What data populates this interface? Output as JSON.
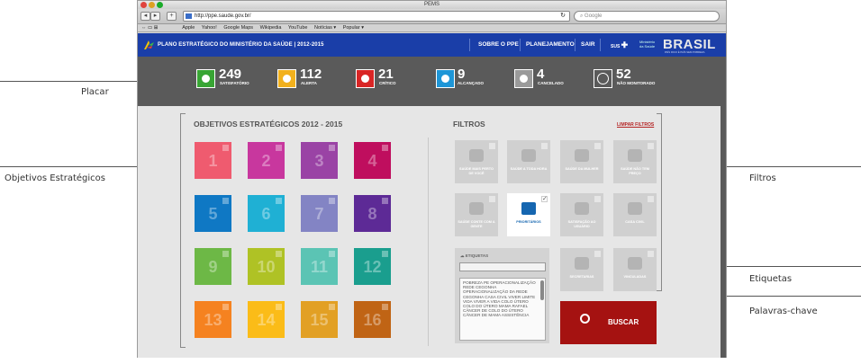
{
  "browser": {
    "window_title": "PEMS",
    "url": "http://ppe.saude.gov.br/",
    "search_placeholder": "Google",
    "bookmarks": [
      "Apple",
      "Yahoo!",
      "Google Maps",
      "Wikipedia",
      "YouTube",
      "Notícias ▾",
      "Popular ▾"
    ]
  },
  "header": {
    "title": "PLANO ESTRATÉGICO DO MINISTÉRIO DA SAÚDE | 2012-2015",
    "nav": [
      "SOBRE O PPE",
      "PLANEJAMENTO",
      "SAIR"
    ],
    "sus": "SUS",
    "ministerio": "Ministério da Saúde",
    "brasil": "BRASIL",
    "brasil_sub": "PAÍS RICO É PAÍS SEM POBREZA"
  },
  "placar": [
    {
      "value": "249",
      "label": "SATISFATÓRIO",
      "color": "#38a534"
    },
    {
      "value": "112",
      "label": "ALERTA",
      "color": "#f2b11d"
    },
    {
      "value": "21",
      "label": "CRÍTICO",
      "color": "#d92525"
    },
    {
      "value": "9",
      "label": "ALCANÇADO",
      "color": "#1e96d7"
    },
    {
      "value": "4",
      "label": "CANCELADO",
      "color": "#9a9a9a"
    },
    {
      "value": "52",
      "label": "NÃO MONITORADO",
      "color": "#5a5a5a"
    }
  ],
  "objetivos": {
    "title": "OBJETIVOS ESTRATÉGICOS 2012 - 2015",
    "items": [
      {
        "n": "1",
        "color": "#ef5b6f"
      },
      {
        "n": "2",
        "color": "#c8379e"
      },
      {
        "n": "3",
        "color": "#9a43a5"
      },
      {
        "n": "4",
        "color": "#bf0e5e"
      },
      {
        "n": "5",
        "color": "#0f78c4"
      },
      {
        "n": "6",
        "color": "#1fb0d4"
      },
      {
        "n": "7",
        "color": "#8384c4"
      },
      {
        "n": "8",
        "color": "#5d2a96"
      },
      {
        "n": "9",
        "color": "#6db846"
      },
      {
        "n": "10",
        "color": "#afc225"
      },
      {
        "n": "11",
        "color": "#5bc4b4"
      },
      {
        "n": "12",
        "color": "#1a9e8e"
      },
      {
        "n": "13",
        "color": "#f58220"
      },
      {
        "n": "14",
        "color": "#fbbc18"
      },
      {
        "n": "15",
        "color": "#e2a024"
      },
      {
        "n": "16",
        "color": "#c06415"
      }
    ]
  },
  "filtros": {
    "title": "FILTROS",
    "limpar": "LIMPAR FILTROS",
    "items": [
      {
        "label": "SAÚDE MAIS PERTO DE VOCÊ",
        "active": false
      },
      {
        "label": "SAÚDE A TODA HORA",
        "active": false
      },
      {
        "label": "SAÚDE DA MULHER",
        "active": false
      },
      {
        "label": "SAÚDE NÃO TEM PREÇO",
        "active": false
      },
      {
        "label": "SAÚDE CONTE COM A GENTE",
        "active": false
      },
      {
        "label": "PRIORITÁRIOS",
        "active": true
      },
      {
        "label": "SATISFAÇÃO AO USUÁRIO",
        "active": false
      },
      {
        "label": "CASA CIVIL",
        "active": false
      },
      {
        "label": "SECRETARIAS",
        "active": false
      },
      {
        "label": "VINCULADAS",
        "active": false
      }
    ],
    "etiquetas": {
      "title": "ETIQUETAS",
      "tags": "POBREZA PE OPERACIONALIZAÇÃO REDE CEGONHA OPERACIONALIZAÇÃO DA REDE CEGONHA CASA CIVIL VIVER LIMITE VIDA VIVER A VIDA COLO ÚTERO COLO DO ÚTERO MAMA RAFAEL CÂNCER DE COLO DO ÚTERO CÂNCER DE MAMA ASSISTÊNCIA"
    },
    "buscar": "BUSCAR"
  },
  "callouts": {
    "placar": "Placar",
    "objetivos": "Objetivos Estratégicos",
    "filtros": "Filtros",
    "etiquetas": "Etiquetas",
    "palavras": "Palavras-chave"
  }
}
